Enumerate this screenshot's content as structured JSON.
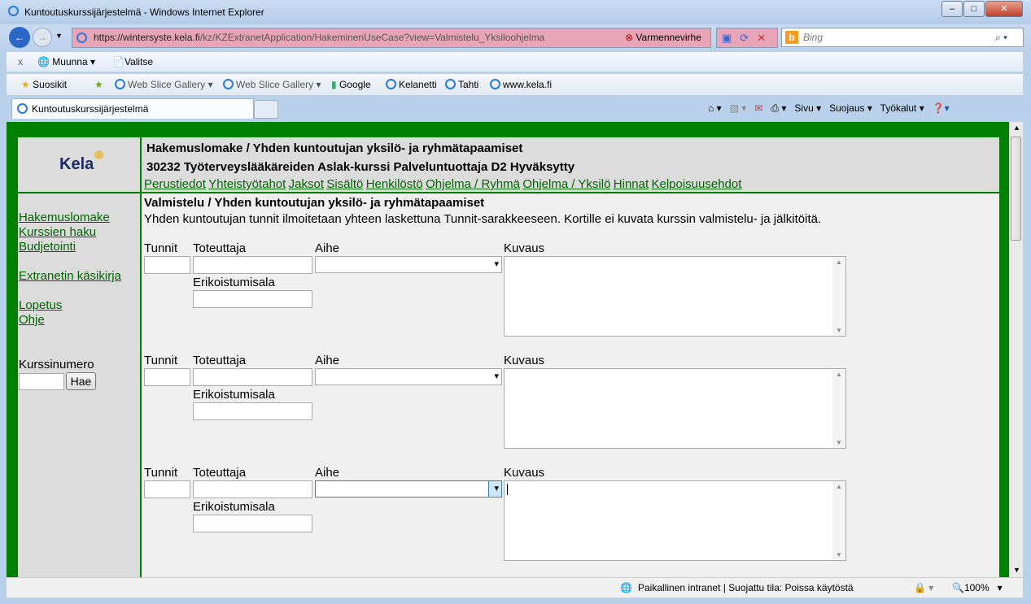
{
  "browser": {
    "title": "Kuntoutuskurssijärjestelmä - Windows Internet Explorer",
    "url_host": "https://wintersyste.kela.fi",
    "url_path": "/kz/KZExtranetApplication/HakeminenUseCase?view=Valmistelu_Yksiloohjelma",
    "cert_error": "Varmennevirhe",
    "search_placeholder": "Bing",
    "toolbar1": [
      "Muunna",
      "Valitse"
    ],
    "favorites": {
      "label": "Suosikit",
      "items": [
        "Web Slice Gallery",
        "Web Slice Gallery",
        "Google",
        "Kelanetti",
        "Tahti",
        "www.kela.fi"
      ]
    },
    "tab_title": "Kuntoutuskurssijärjestelmä",
    "commands": [
      "Sivu",
      "Suojaus",
      "Työkalut"
    ],
    "status_zone": "Paikallinen intranet | Suojattu tila: Poissa käytöstä",
    "zoom": "100%"
  },
  "page": {
    "logo": "Kela",
    "heading": "Hakemuslomake / Yhden kuntoutujan yksilö- ja ryhmätapaamiset",
    "subheading": "30232 Työterveyslääkäreiden Aslak-kurssi Palveluntuottaja D2 Hyväksytty",
    "tabs": [
      "Perustiedot",
      "Yhteistyötahot",
      "Jaksot",
      "Sisältö",
      "Henkilöstö",
      "Ohjelma / Ryhmä",
      "Ohjelma / Yksilö",
      "Hinnat",
      "Kelpoisuusehdot"
    ],
    "nav": [
      "Hakemuslomake",
      "Kurssien haku",
      "Budjetointi",
      "Extranetin käsikirja",
      "Lopetus",
      "Ohje"
    ],
    "course_label": "Kurssinumero",
    "search_button": "Hae",
    "section_title": "Valmistelu / Yhden kuntoutujan yksilö- ja ryhmätapaamiset",
    "section_info": "Yhden kuntoutujan tunnit ilmoitetaan yhteen laskettuna Tunnit-sarakkeeseen. Kortille ei kuvata kurssin valmistelu- ja jälkitöitä.",
    "labels": {
      "hours": "Tunnit",
      "provider": "Toteuttaja",
      "topic": "Aihe",
      "description": "Kuvaus",
      "specialty": "Erikoistumisala"
    }
  }
}
